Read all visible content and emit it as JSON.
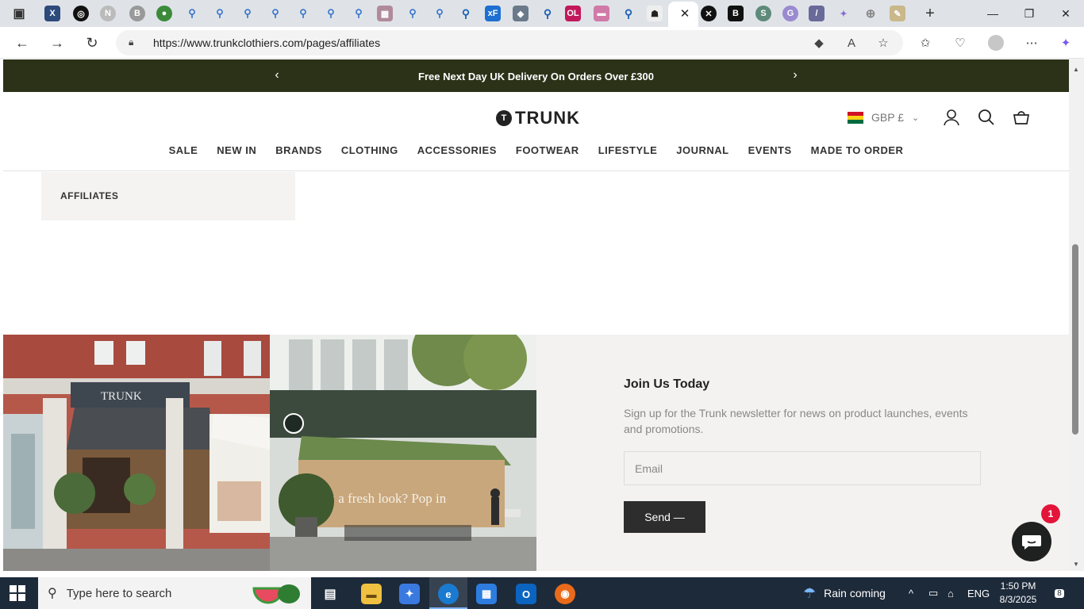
{
  "browser": {
    "address_url": "https://www.trunkclothiers.com/pages/affiliates",
    "active_tab_close": "✕"
  },
  "site": {
    "announcement": "Free Next Day UK Delivery On Orders Over £300",
    "logo_text": "TRUNK",
    "logo_mark": "T",
    "currency": "GBP £",
    "nav": [
      "SALE",
      "NEW IN",
      "BRANDS",
      "CLOTHING",
      "ACCESSORIES",
      "FOOTWEAR",
      "LIFESTYLE",
      "JOURNAL",
      "EVENTS",
      "MADE TO ORDER"
    ],
    "sidebar_item": "AFFILIATES"
  },
  "newsletter": {
    "title": "Join Us Today",
    "description": "Sign up for the Trunk newsletter for news on product launches, events and promotions.",
    "email_placeholder": "Email",
    "send_label": "Send —"
  },
  "photo_text": {
    "storefront_sign": "TRUNK",
    "window_text": "cy a fresh look? Pop in"
  },
  "chat": {
    "badge_count": "1"
  },
  "taskbar": {
    "search_placeholder": "Type here to search",
    "weather": "Rain coming",
    "language": "ENG",
    "time": "1:50 PM",
    "date": "8/3/2025",
    "notification_count": "8"
  },
  "colors": {
    "announcement_bg": "#2b3218",
    "send_button_bg": "#2d2d2d",
    "chat_badge": "#e3153a",
    "newsletter_bg": "#f3f2f0"
  }
}
